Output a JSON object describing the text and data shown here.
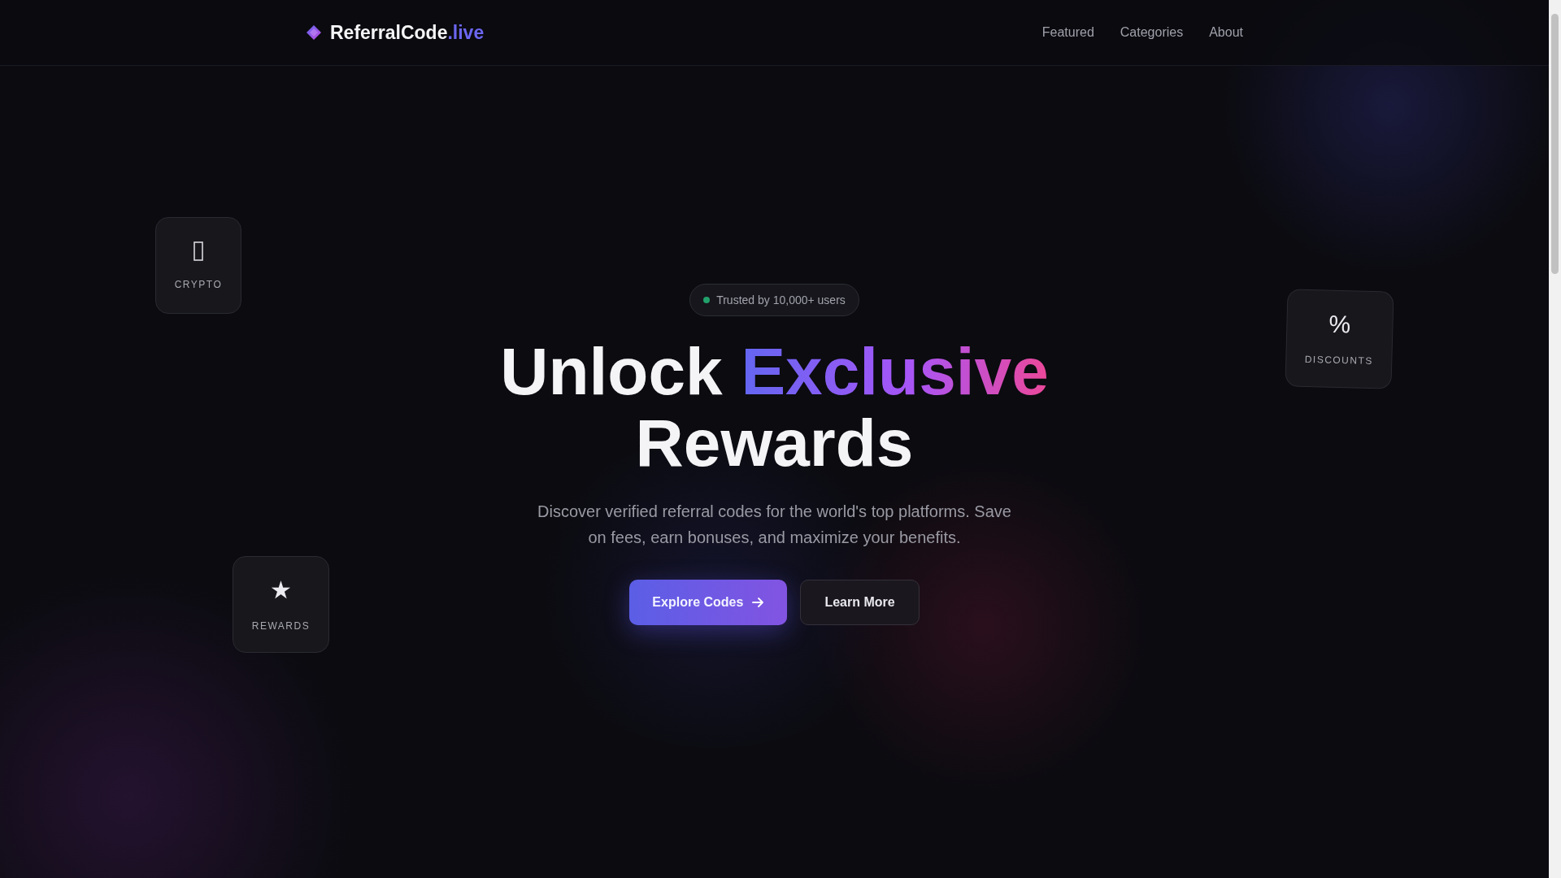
{
  "nav": {
    "logo": {
      "name": "ReferralCode",
      "accent": ".live"
    },
    "links": [
      "Featured",
      "Categories",
      "About"
    ]
  },
  "hero": {
    "badge": {
      "text": "Trusted by 10,000+ users",
      "color": "#22a06b"
    },
    "title": {
      "lead": "Unlock",
      "highlight": "Exclusive",
      "tail": "Rewards"
    },
    "subtitle": "Discover verified referral codes for the world's top platforms. Save on fees, earn bonuses, and maximize your benefits.",
    "buttons": [
      {
        "label": "Explore Codes",
        "kind": "primary"
      },
      {
        "label": "Learn More",
        "kind": "secondary"
      }
    ]
  },
  "floating_cards": [
    {
      "kind": "glyph-box",
      "label": "CRYPTO"
    },
    {
      "kind": "symbol",
      "symbol": "%",
      "label": "DISCOUNTS"
    },
    {
      "kind": "symbol",
      "symbol": "★",
      "label": "REWARDS"
    }
  ]
}
